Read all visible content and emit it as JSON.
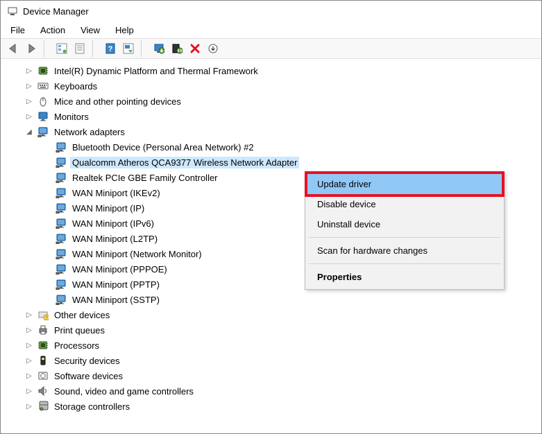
{
  "window": {
    "title": "Device Manager"
  },
  "menu": {
    "file": "File",
    "action": "Action",
    "view": "View",
    "help": "Help"
  },
  "tree": {
    "cat0": "Intel(R) Dynamic Platform and Thermal Framework",
    "cat1": "Keyboards",
    "cat2": "Mice and other pointing devices",
    "cat3": "Monitors",
    "cat4": "Network adapters",
    "net0": "Bluetooth Device (Personal Area Network) #2",
    "net1": "Qualcomm Atheros QCA9377 Wireless Network Adapter",
    "net2": "Realtek PCIe GBE Family Controller",
    "net3": "WAN Miniport (IKEv2)",
    "net4": "WAN Miniport (IP)",
    "net5": "WAN Miniport (IPv6)",
    "net6": "WAN Miniport (L2TP)",
    "net7": "WAN Miniport (Network Monitor)",
    "net8": "WAN Miniport (PPPOE)",
    "net9": "WAN Miniport (PPTP)",
    "net10": "WAN Miniport (SSTP)",
    "cat5": "Other devices",
    "cat6": "Print queues",
    "cat7": "Processors",
    "cat8": "Security devices",
    "cat9": "Software devices",
    "cat10": "Sound, video and game controllers",
    "cat11": "Storage controllers"
  },
  "context": {
    "update": "Update driver",
    "disable": "Disable device",
    "uninstall": "Uninstall device",
    "scan": "Scan for hardware changes",
    "props": "Properties"
  }
}
